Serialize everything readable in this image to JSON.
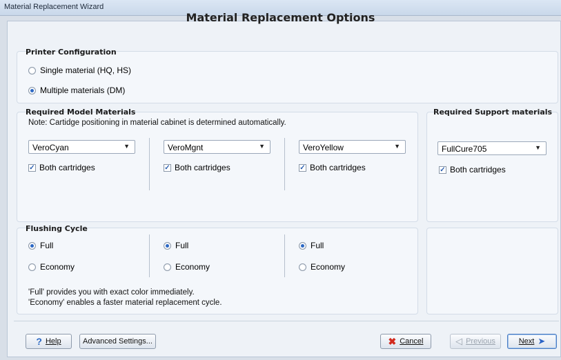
{
  "window": {
    "title": "Material Replacement Wizard"
  },
  "heading": "Material Replacement Options",
  "printer_config": {
    "title": "Printer Configuration",
    "options": [
      {
        "label": "Single material (HQ, HS)",
        "selected": false
      },
      {
        "label": "Multiple materials (DM)",
        "selected": true
      }
    ]
  },
  "model_materials": {
    "title": "Required Model Materials",
    "note": "Note: Cartidge positioning in material cabinet is determined automatically.",
    "columns": [
      {
        "material": "VeroCyan",
        "both_label": "Both cartridges",
        "both_checked": true
      },
      {
        "material": "VeroMgnt",
        "both_label": "Both cartridges",
        "both_checked": true
      },
      {
        "material": "VeroYellow",
        "both_label": "Both cartridges",
        "both_checked": true
      }
    ]
  },
  "support_materials": {
    "title": "Required Support materials",
    "material": "FullCure705",
    "both_label": "Both cartridges",
    "both_checked": true
  },
  "flushing": {
    "title": "Flushing Cycle",
    "columns": [
      {
        "full": "Full",
        "economy": "Economy",
        "selected": "full"
      },
      {
        "full": "Full",
        "economy": "Economy",
        "selected": "full"
      },
      {
        "full": "Full",
        "economy": "Economy",
        "selected": "full"
      }
    ],
    "note1": "'Full' provides you with exact color immediately.",
    "note2": "'Economy' enables a faster material replacement cycle."
  },
  "buttons": {
    "help": "Help",
    "advanced": "Advanced Settings...",
    "cancel": "Cancel",
    "previous": "Previous",
    "next": "Next"
  },
  "colors": {
    "accent": "#2b68c4",
    "cancel_x": "#d22a1e",
    "next_arrow": "#2a63c6"
  }
}
